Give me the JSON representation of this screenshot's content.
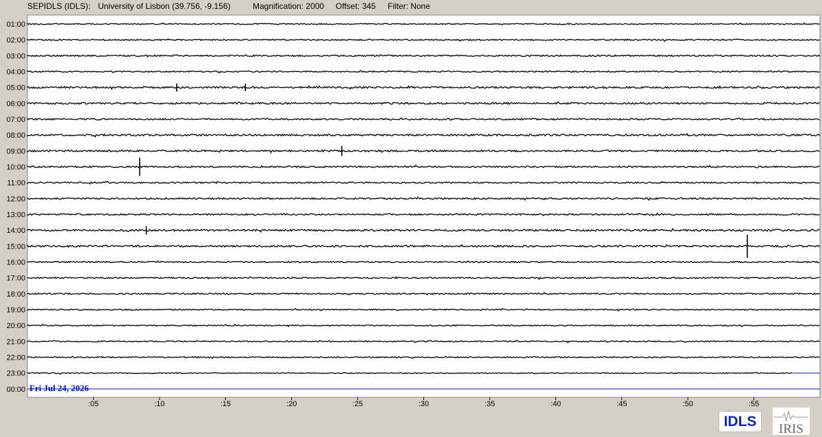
{
  "header": {
    "station": "SEPIDLS (IDLS):",
    "location": "University of Lisbon (39.756, -9.156)",
    "magnification": "Magnification: 2000",
    "offset": "Offset: 345",
    "filter": "Filter: None"
  },
  "chart_data": {
    "type": "line",
    "title": "",
    "date_label": "Fri Jul 24, 2026",
    "hour_labels": [
      "01:00",
      "02:00",
      "03:00",
      "04:00",
      "05:00",
      "06:00",
      "07:00",
      "08:00",
      "09:00",
      "10:00",
      "11:00",
      "12:00",
      "13:00",
      "14:00",
      "15:00",
      "16:00",
      "17:00",
      "18:00",
      "19:00",
      "20:00",
      "21:00",
      "22:00",
      "23:00",
      "00:00"
    ],
    "minute_ticks": [
      ":05",
      ":10",
      ":15",
      ":20",
      ":25",
      ":30",
      ":35",
      ":40",
      ":45",
      ":50",
      ":55"
    ],
    "minute_values": [
      5,
      10,
      15,
      20,
      25,
      30,
      35,
      40,
      45,
      50,
      55
    ],
    "x_range_minutes": [
      0,
      60
    ],
    "trace_color": "#000000",
    "date_color": "#0018c8",
    "marker_line_color": "#0018c8",
    "current_trace_end_minute": 58,
    "noise_level": [
      0.5,
      0.6,
      0.7,
      0.6,
      0.8,
      0.8,
      0.7,
      0.8,
      0.8,
      0.7,
      0.6,
      0.7,
      0.7,
      0.8,
      0.8,
      0.6,
      0.6,
      0.6,
      0.5,
      0.5,
      0.5,
      0.5,
      0.4
    ],
    "events": [
      {
        "hour": "10:00",
        "minute": 8.5,
        "amplitude": 2.2
      },
      {
        "hour": "15:00",
        "minute": 54.5,
        "amplitude": 2.8
      },
      {
        "hour": "09:00",
        "minute": 23.8,
        "amplitude": 1.2
      },
      {
        "hour": "05:00",
        "minute": 11.3,
        "amplitude": 1.0
      },
      {
        "hour": "05:00",
        "minute": 16.5,
        "amplitude": 0.9
      },
      {
        "hour": "14:00",
        "minute": 9.0,
        "amplitude": 1.0
      }
    ]
  },
  "logos": {
    "station_badge": "IDLS",
    "network": "IRIS"
  },
  "colors": {
    "background": "#d4d0c8",
    "plot_background": "#ffffff",
    "badge_text": "#0b27c8"
  }
}
